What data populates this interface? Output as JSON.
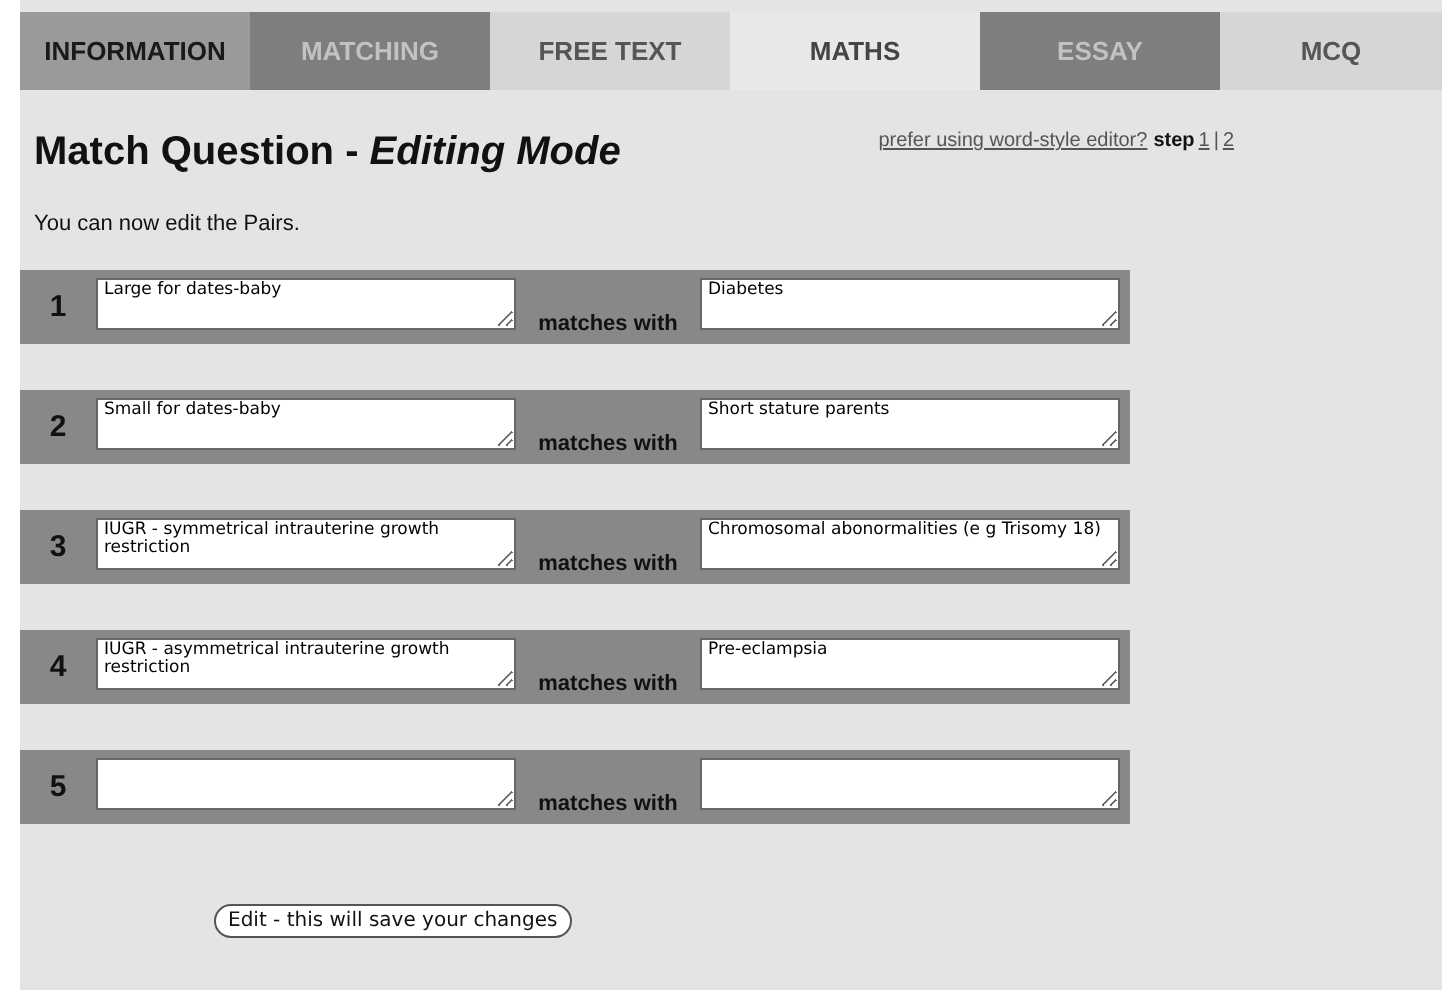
{
  "tabs": [
    {
      "label": "INFORMATION",
      "kind": "medium",
      "selected": false
    },
    {
      "label": "MATCHING",
      "kind": "dim",
      "selected": false
    },
    {
      "label": "FREE TEXT",
      "kind": "light",
      "selected": false
    },
    {
      "label": "MATHS",
      "kind": "light",
      "selected": true
    },
    {
      "label": "ESSAY",
      "kind": "dim",
      "selected": false
    },
    {
      "label": "MCQ",
      "kind": "light",
      "selected": false
    }
  ],
  "title": "Match Question - *Editing Mode*",
  "editor_link": "prefer using word-style editor?",
  "step_label": "step",
  "steps": [
    "1",
    "2"
  ],
  "step_separator": "|",
  "intro": "You can now edit the Pairs.",
  "pairs": [
    {
      "number": "1",
      "left": "Large for dates-baby",
      "connector": "matches with",
      "right": "Diabetes"
    },
    {
      "number": "2",
      "left": "Small for dates-baby",
      "connector": "matches with",
      "right": "Short stature parents"
    },
    {
      "number": "3",
      "left": "IUGR - symmetrical intrauterine growth restriction",
      "connector": "matches with",
      "right": "Chromosomal abonormalities (e g Trisomy 18)"
    },
    {
      "number": "4",
      "left": "IUGR - asymmetrical intrauterine growth restriction",
      "connector": "matches with",
      "right": "Pre-eclampsia"
    },
    {
      "number": "5",
      "connector": "matches with"
    }
  ],
  "submit_button": "Edit - this will save your changes"
}
